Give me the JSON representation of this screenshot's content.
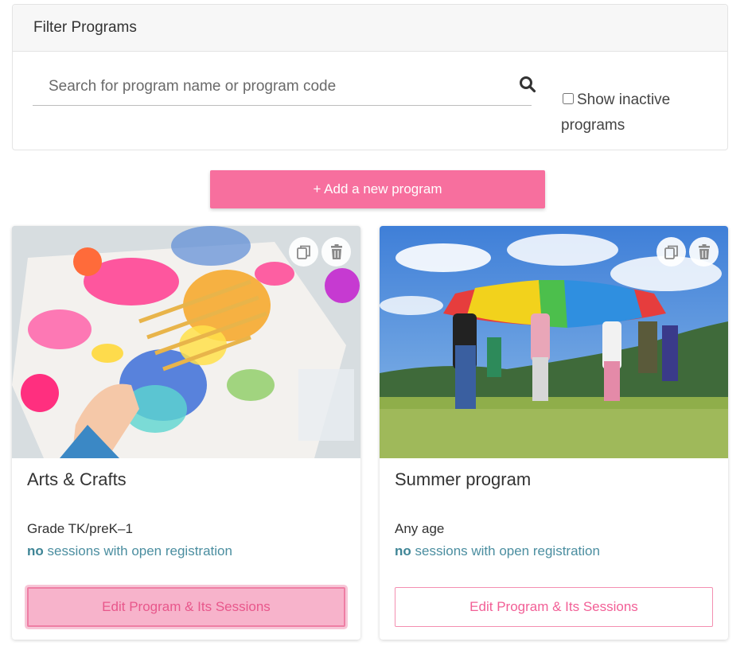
{
  "filter": {
    "title": "Filter Programs",
    "search_placeholder": "Search for program name or program code",
    "search_value": "",
    "show_inactive_label": "Show inactive programs",
    "show_inactive_checked": false
  },
  "add_button": {
    "label": "+ Add a new program"
  },
  "programs": [
    {
      "title": "Arts & Crafts",
      "age": "Grade TK/preK–1",
      "sessions_prefix": "no",
      "sessions_text": " sessions with open registration",
      "edit_label": "Edit Program & Its Sessions",
      "image": "arts-crafts-photo"
    },
    {
      "title": "Summer program",
      "age": "Any age",
      "sessions_prefix": "no",
      "sessions_text": " sessions with open registration",
      "edit_label": "Edit Program & Its Sessions",
      "image": "summer-parachute-photo"
    }
  ],
  "icons": {
    "copy": "copy-icon",
    "delete": "trash-icon",
    "search": "search-icon"
  },
  "colors": {
    "accent": "#f76f9e",
    "link": "#4b8ea0"
  }
}
